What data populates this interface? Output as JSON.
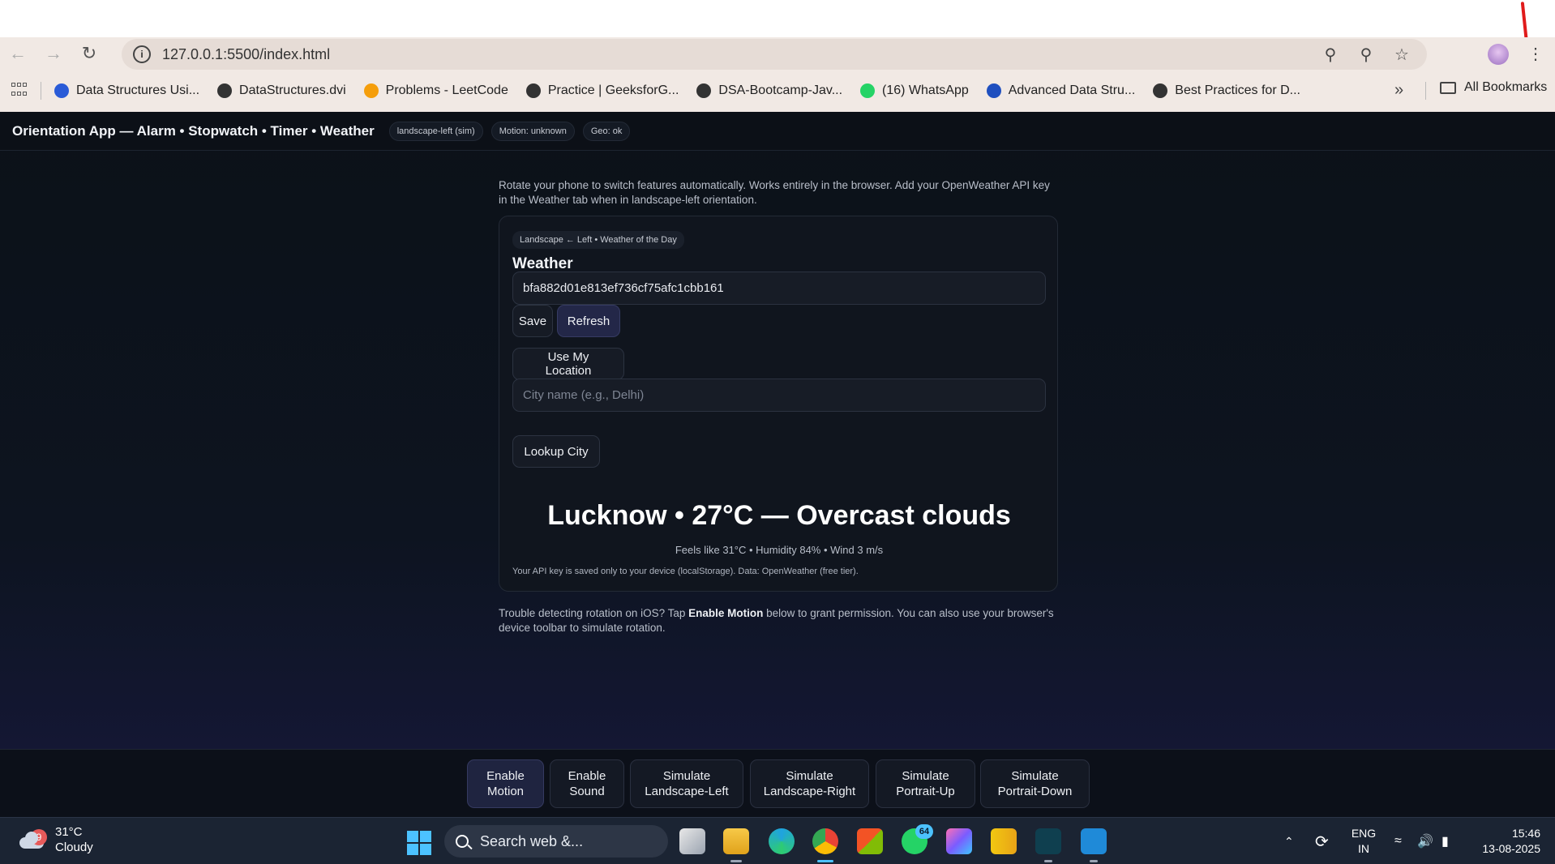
{
  "browser": {
    "url": "127.0.0.1:5500/index.html",
    "bookmarks": [
      {
        "label": "Data Structures Usi...",
        "icon": "bu-icon",
        "color": "#2a5bd7"
      },
      {
        "label": "DataStructures.dvi",
        "icon": "globe-icon",
        "color": "#333333"
      },
      {
        "label": "Problems - LeetCode",
        "icon": "leetcode-icon",
        "color": "#f59e0b"
      },
      {
        "label": "Practice | GeeksforG...",
        "icon": "globe-icon",
        "color": "#333333"
      },
      {
        "label": "DSA-Bootcamp-Jav...",
        "icon": "globe-icon",
        "color": "#333333"
      },
      {
        "label": "(16) WhatsApp",
        "icon": "whatsapp-icon",
        "color": "#25d366"
      },
      {
        "label": "Advanced Data Stru...",
        "icon": "unacademy-icon",
        "color": "#1f4fbf"
      },
      {
        "label": "Best Practices for D...",
        "icon": "globe-icon",
        "color": "#333333"
      }
    ],
    "all_bookmarks": "All Bookmarks"
  },
  "app": {
    "title": "Orientation App — Alarm • Stopwatch • Timer • Weather",
    "pills": [
      "landscape-left (sim)",
      "Motion: unknown",
      "Geo: ok"
    ],
    "intro": "Rotate your phone to switch features automatically. Works entirely in the browser. Add your OpenWeather API key in the Weather tab when in landscape-left orientation.",
    "card": {
      "badge": "Landscape ← Left • Weather of the Day",
      "title": "Weather",
      "api_key_value": "bfa882d01e813ef736cf75afc1cbb161",
      "save_label": "Save",
      "refresh_label": "Refresh",
      "location_label": "Use My Location",
      "city_placeholder": "City name (e.g., Delhi)",
      "lookup_label": "Lookup City",
      "weather_main": "Lucknow • 27°C — Overcast clouds",
      "weather_sub": "Feels like 31°C • Humidity 84% • Wind 3 m/s",
      "note": "Your API key is saved only to your device (localStorage). Data: OpenWeather (free tier)."
    },
    "trouble_pre": "Trouble detecting rotation on iOS? Tap ",
    "trouble_bold": "Enable Motion",
    "trouble_post": " below to grant permission. You can also use your browser's device toolbar to simulate rotation.",
    "bottom_buttons": [
      {
        "line1": "Enable",
        "line2": "Motion"
      },
      {
        "line1": "Enable",
        "line2": "Sound"
      },
      {
        "line1": "Simulate",
        "line2": "Landscape-Left"
      },
      {
        "line1": "Simulate",
        "line2": "Landscape-Right"
      },
      {
        "line1": "Simulate",
        "line2": "Portrait-Up"
      },
      {
        "line1": "Simulate",
        "line2": "Portrait-Down"
      }
    ]
  },
  "taskbar": {
    "weather_badge": "9",
    "temp": "31°C",
    "condition": "Cloudy",
    "search": "Search web &...",
    "whatsapp_badge": "64",
    "lang1": "ENG",
    "lang2": "IN",
    "time": "15:46",
    "date": "13-08-2025"
  },
  "colors": {
    "accent": "#232748",
    "windows_blue": "#4cc2ff"
  }
}
